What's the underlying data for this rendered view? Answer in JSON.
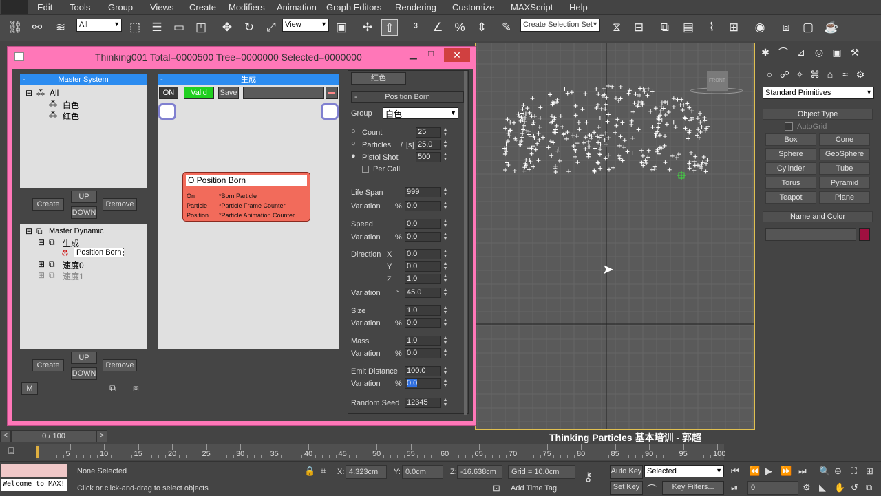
{
  "menu": [
    "Edit",
    "Tools",
    "Group",
    "Views",
    "Create",
    "Modifiers",
    "Animation",
    "Graph Editors",
    "Rendering",
    "Customize",
    "MAXScript",
    "Help"
  ],
  "toolbar": {
    "filter_select": "All",
    "ref_coord": "View",
    "selection_set_placeholder": "Create Selection Set"
  },
  "tp_window": {
    "title": "Thinking001  Total=0000500  Tree=0000000  Selected=0000000",
    "master_system": {
      "header": "Master System",
      "items": [
        "All",
        "白色",
        "红色"
      ],
      "buttons": {
        "create": "Create",
        "up": "UP",
        "down": "DOWN",
        "remove": "Remove"
      }
    },
    "master_dynamic": {
      "items": [
        "Master Dynamic",
        "生成",
        "Position Born",
        "速度0",
        "速度1"
      ],
      "buttons": {
        "create": "Create",
        "up": "UP",
        "down": "DOWN",
        "remove": "Remove",
        "m": "M"
      }
    },
    "graph": {
      "header": "生成",
      "on": "ON",
      "valid": "Valid",
      "save": "Save",
      "node": {
        "title": "O Position Born",
        "rows": [
          {
            "port": "On",
            "value": "*Born Particle"
          },
          {
            "port": "Particle",
            "value": "*Particle Frame Counter"
          },
          {
            "port": "Position",
            "value": "*Particle Animation Counter"
          }
        ]
      }
    },
    "params": {
      "group_tab": "红色",
      "rollout": "Position Born",
      "group_label": "Group",
      "group_value": "白色",
      "count": {
        "label": "Count",
        "value": "25"
      },
      "particles": {
        "label": "Particles",
        "slash": "/",
        "unit": "[s]",
        "value": "25.0"
      },
      "pistol": {
        "label": "Pistol Shot",
        "value": "500"
      },
      "per_call": "Per Call",
      "life_span": {
        "label": "Life Span",
        "value": "999"
      },
      "life_var": {
        "label": "Variation",
        "unit": "%",
        "value": "0.0"
      },
      "speed": {
        "label": "Speed",
        "value": "0.0"
      },
      "speed_var": {
        "label": "Variation",
        "unit": "%",
        "value": "0.0"
      },
      "direction": {
        "label": "Direction",
        "x_label": "X",
        "x": "0.0",
        "y_label": "Y",
        "y": "0.0",
        "z_label": "Z",
        "z": "1.0"
      },
      "dir_var": {
        "label": "Variation",
        "unit": "°",
        "value": "45.0"
      },
      "size": {
        "label": "Size",
        "value": "1.0"
      },
      "size_var": {
        "label": "Variation",
        "unit": "%",
        "value": "0.0"
      },
      "mass": {
        "label": "Mass",
        "value": "1.0"
      },
      "mass_var": {
        "label": "Variation",
        "unit": "%",
        "value": "0.0"
      },
      "emit": {
        "label": "Emit Distance",
        "value": "100.0"
      },
      "emit_var": {
        "label": "Variation",
        "unit": "%",
        "value": "0.0"
      },
      "seed": {
        "label": "Random Seed",
        "value": "12345"
      }
    }
  },
  "viewport": {
    "cube_label": "FRONT"
  },
  "command_panel": {
    "category": "Standard Primitives",
    "object_type_header": "Object Type",
    "autogrid": "AutoGrid",
    "buttons": [
      "Box",
      "Cone",
      "Sphere",
      "GeoSphere",
      "Cylinder",
      "Tube",
      "Torus",
      "Pyramid",
      "Teapot",
      "Plane"
    ],
    "name_color_header": "Name and Color",
    "color": "#a01040"
  },
  "timeline": {
    "frame": "0 / 100",
    "ticks": [
      "5",
      "10",
      "15",
      "20",
      "25",
      "30",
      "35",
      "40",
      "45",
      "50",
      "55",
      "60",
      "65",
      "70",
      "75",
      "80",
      "85",
      "90",
      "95",
      "100"
    ],
    "watermark": "Thinking Particles 基本培训 - 郭超"
  },
  "status": {
    "script": "Welcome to MAX!",
    "selection": "None Selected",
    "prompt": "Click or click-and-drag to select objects",
    "x_label": "X:",
    "x": "4.323cm",
    "y_label": "Y:",
    "y": "0.0cm",
    "z_label": "Z:",
    "z": "-16.638cm",
    "grid": "Grid = 10.0cm",
    "add_time_tag": "Add Time Tag",
    "auto_key": "Auto Key",
    "selected": "Selected",
    "set_key": "Set Key",
    "key_filters": "Key Filters...",
    "frame_value": "0"
  }
}
